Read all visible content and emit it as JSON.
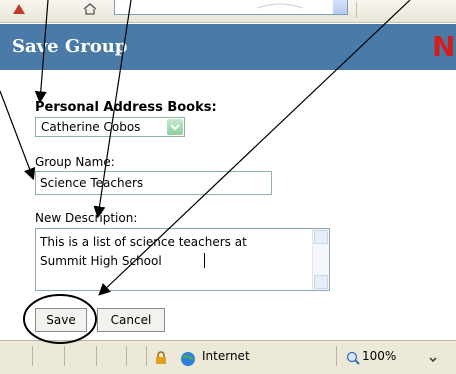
{
  "header": {
    "title": "Save Group",
    "logo": "N"
  },
  "form": {
    "address_books_label": "Personal Address Books:",
    "address_book_value": "Catherine Cobos",
    "group_name_label": "Group Name:",
    "group_name_value": "Science Teachers",
    "description_label": "New Description:",
    "description_value": "This is a list of science teachers at\nSummit High School"
  },
  "buttons": {
    "save": "Save",
    "cancel": "Cancel"
  },
  "status": {
    "zone": "Internet",
    "zoom": "100%"
  },
  "icons": [
    "red-app-icon",
    "dropdown-arrow-icon",
    "lock-icon",
    "globe-icon",
    "magnifier-icon",
    "scroll-up-icon",
    "scroll-down-icon"
  ],
  "colors": {
    "banner": "#4a7aa7",
    "logo": "#d21e1e",
    "field_border": "#8fb49a"
  }
}
